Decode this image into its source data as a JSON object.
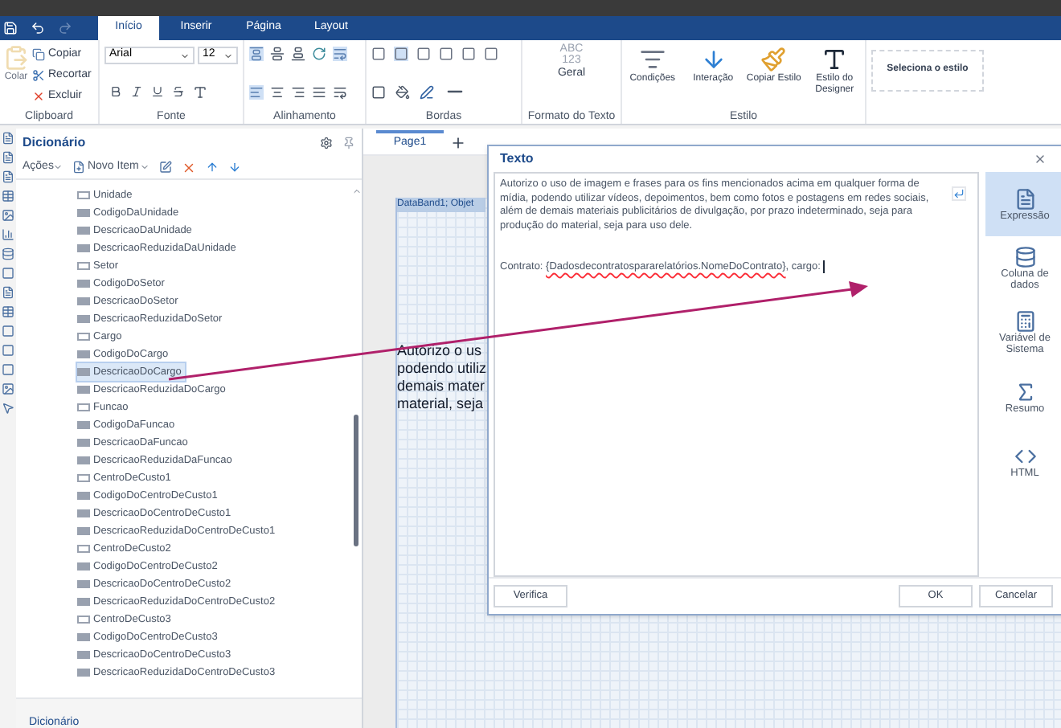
{
  "ribbon_tabs": [
    {
      "label": "Início",
      "selected": true
    },
    {
      "label": "Inserir",
      "selected": false
    },
    {
      "label": "Página",
      "selected": false
    },
    {
      "label": "Layout",
      "selected": false
    }
  ],
  "clipboard": {
    "group": "Clipboard",
    "paste": "Colar",
    "copy": "Copiar",
    "cut": "Recortar",
    "delete": "Excluir"
  },
  "font": {
    "group": "Fonte",
    "family": "Arial",
    "size": "12"
  },
  "alignment": {
    "group": "Alinhamento"
  },
  "borders": {
    "group": "Bordas"
  },
  "text_format": {
    "group": "Formato do Texto",
    "preview_1": "ABC",
    "preview_2": "123",
    "format": "Geral"
  },
  "style": {
    "group": "Estilo",
    "buttons": [
      {
        "label": "Condições",
        "kind": "conditions"
      },
      {
        "label": "Interação",
        "kind": "interaction"
      },
      {
        "label": "Copiar Estilo",
        "kind": "copy"
      },
      {
        "label": "Estilo do Designer",
        "kind": "designer"
      }
    ],
    "selector": "Seleciona o estilo"
  },
  "dictionary": {
    "title": "Dicionário",
    "actions": "Ações",
    "new_item": "Novo Item",
    "bottom_tab": "Dicionário",
    "items": [
      {
        "label": "Unidade",
        "kind": "number",
        "selected": false
      },
      {
        "label": "CodigoDaUnidade",
        "kind": "text",
        "selected": false
      },
      {
        "label": "DescricaoDaUnidade",
        "kind": "text",
        "selected": false
      },
      {
        "label": "DescricaoReduzidaDaUnidade",
        "kind": "text",
        "selected": false
      },
      {
        "label": "Setor",
        "kind": "number",
        "selected": false
      },
      {
        "label": "CodigoDoSetor",
        "kind": "text",
        "selected": false
      },
      {
        "label": "DescricaoDoSetor",
        "kind": "text",
        "selected": false
      },
      {
        "label": "DescricaoReduzidaDoSetor",
        "kind": "text",
        "selected": false
      },
      {
        "label": "Cargo",
        "kind": "number",
        "selected": false
      },
      {
        "label": "CodigoDoCargo",
        "kind": "text",
        "selected": false
      },
      {
        "label": "DescricaoDoCargo",
        "kind": "text",
        "selected": true
      },
      {
        "label": "DescricaoReduzidaDoCargo",
        "kind": "text",
        "selected": false
      },
      {
        "label": "Funcao",
        "kind": "number",
        "selected": false
      },
      {
        "label": "CodigoDaFuncao",
        "kind": "text",
        "selected": false
      },
      {
        "label": "DescricaoDaFuncao",
        "kind": "text",
        "selected": false
      },
      {
        "label": "DescricaoReduzidaDaFuncao",
        "kind": "text",
        "selected": false
      },
      {
        "label": "CentroDeCusto1",
        "kind": "number",
        "selected": false
      },
      {
        "label": "CodigoDoCentroDeCusto1",
        "kind": "text",
        "selected": false
      },
      {
        "label": "DescricaoDoCentroDeCusto1",
        "kind": "text",
        "selected": false
      },
      {
        "label": "DescricaoReduzidaDoCentroDeCusto1",
        "kind": "text",
        "selected": false
      },
      {
        "label": "CentroDeCusto2",
        "kind": "number",
        "selected": false
      },
      {
        "label": "CodigoDoCentroDeCusto2",
        "kind": "text",
        "selected": false
      },
      {
        "label": "DescricaoDoCentroDeCusto2",
        "kind": "text",
        "selected": false
      },
      {
        "label": "DescricaoReduzidaDoCentroDeCusto2",
        "kind": "text",
        "selected": false
      },
      {
        "label": "CentroDeCusto3",
        "kind": "number",
        "selected": false
      },
      {
        "label": "CodigoDoCentroDeCusto3",
        "kind": "text",
        "selected": false
      },
      {
        "label": "DescricaoDoCentroDeCusto3",
        "kind": "text",
        "selected": false
      },
      {
        "label": "DescricaoReduzidaDoCentroDeCusto3",
        "kind": "text",
        "selected": false
      }
    ]
  },
  "page_tabs": [
    {
      "label": "Page1",
      "selected": true
    }
  ],
  "canvas": {
    "band_label": "DataBand1; Objet",
    "text_lines": [
      "Autorizo o us",
      "podendo utiliz",
      "demais mater",
      "material, seja"
    ]
  },
  "dialog": {
    "title": "Texto",
    "paragraph": "Autorizo o uso de imagem e frases para os fins mencionados acima em qualquer forma de mídia, podendo utilizar vídeos, depoimentos, bem como fotos e postagens em redes sociais, além de demais materiais publicitários de divulgação, por prazo indeterminado, seja para produção do material, seja para uso dele.",
    "contract_prefix": "Contrato: ",
    "contract_expression": "{Dadosdecontratospararelatórios.NomeDoContrato}",
    "contract_suffix": ", cargo:",
    "tools": [
      {
        "label": "Expressão",
        "selected": true
      },
      {
        "label": "Coluna de dados",
        "selected": false
      },
      {
        "label": "Variável de Sistema",
        "selected": false
      },
      {
        "label": "Resumo",
        "selected": false
      },
      {
        "label": "HTML",
        "selected": false
      }
    ],
    "check": "Verifica",
    "ok": "OK",
    "cancel": "Cancelar"
  }
}
